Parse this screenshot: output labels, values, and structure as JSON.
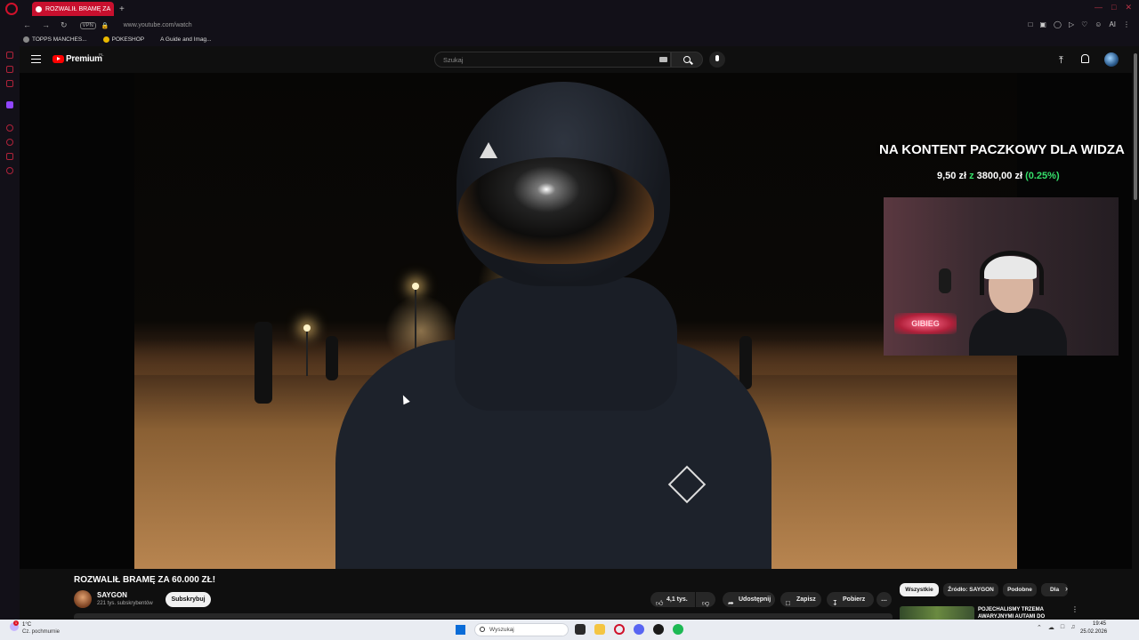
{
  "browser": {
    "tab_title": "ROZWALIŁ BRAMĘ ZA",
    "new_tab_symbol": "+",
    "vpn_label": "VPN",
    "url": "www.youtube.com/watch",
    "window_controls": [
      "—",
      "□",
      "✕"
    ],
    "extension_right_label": "AI",
    "bookmarks": [
      {
        "label": "TOPPS MANCHES..."
      },
      {
        "label": "POKESHOP"
      },
      {
        "label": "A Guide and Imag..."
      }
    ],
    "accent_color": "#d0112b"
  },
  "youtube": {
    "brand": "Premium",
    "region": "PL",
    "search_placeholder": "Szukaj",
    "header_icons": [
      "menu-icon",
      "search-icon",
      "mic-icon",
      "upload-icon",
      "bell-icon",
      "avatar"
    ]
  },
  "video": {
    "overlay_title": "NA KONTENT PACZKOWY DLA WIDZA",
    "overlay_amount": "9,50 zł",
    "overlay_connector": "z",
    "overlay_goal": "3800,00 zł",
    "overlay_percent": "(0.25%)",
    "neon_sign": "GIBIEG"
  },
  "meta": {
    "title": "ROZWALIŁ BRAMĘ ZA 60.000 ZŁ!",
    "channel_name": "SAYGON",
    "channel_subs": "221 tys. subskrybentów",
    "subscribe_label": "Subskrybuj",
    "like_count": "4,1 tys.",
    "share_label": "Udostępnij",
    "save_label": "Zapisz",
    "download_label": "Pobierz",
    "more_label": "…"
  },
  "chips": [
    {
      "label": "Wszystkie",
      "active": true
    },
    {
      "label": "Źródło: SAYGON",
      "active": false
    },
    {
      "label": "Podobne",
      "active": false
    },
    {
      "label": "Dla",
      "active": false
    }
  ],
  "recommendation": {
    "title": "POJECHALIŚMY TRZEMA AWARYJNYMI AUTAMI DO"
  },
  "taskbar": {
    "weather_temp": "1°C",
    "weather_desc": "Cz. pochmurnie",
    "weather_badge": "1",
    "search_placeholder": "Wyszukaj",
    "clock_time": "19:45",
    "clock_date": "25.02.2026"
  }
}
